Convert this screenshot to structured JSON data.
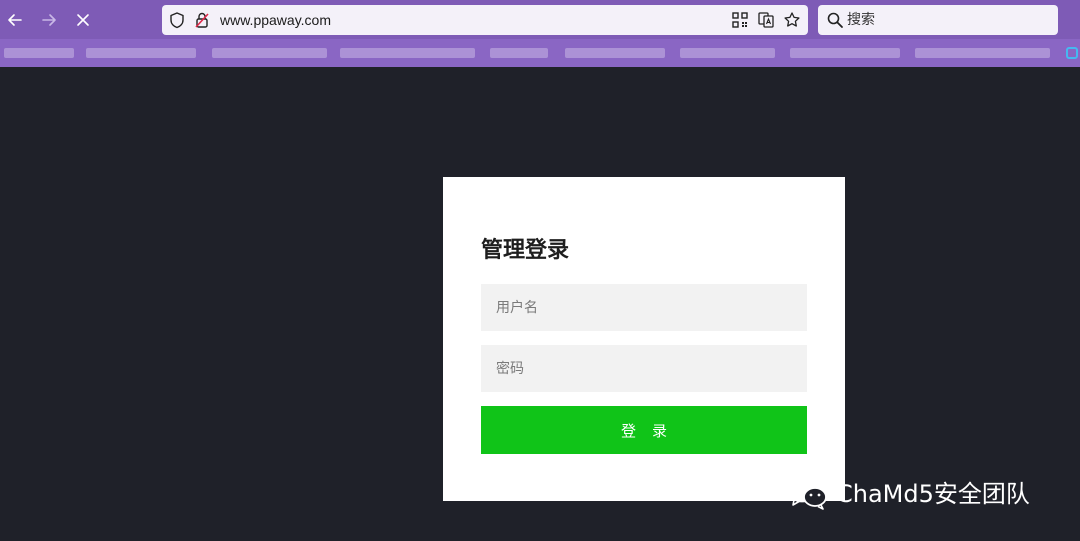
{
  "browser": {
    "url": "www.ppaway.com",
    "search_placeholder": "搜索",
    "accent_color": "#7e5bb6"
  },
  "login": {
    "title": "管理登录",
    "username_placeholder": "用户名",
    "password_placeholder": "密码",
    "submit_label": "登录",
    "button_color": "#10c418"
  },
  "watermark": {
    "text": "ChaMd5安全团队"
  }
}
